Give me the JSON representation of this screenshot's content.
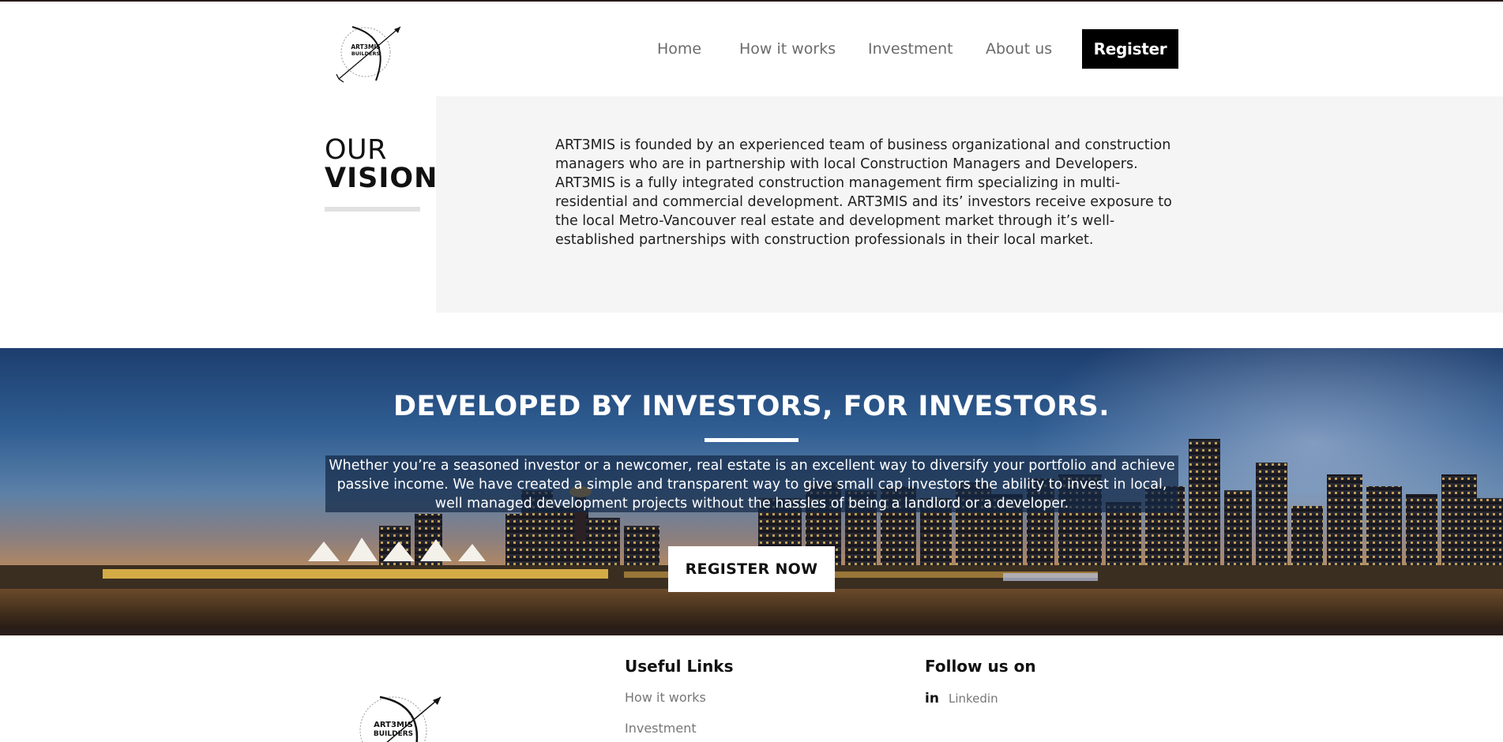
{
  "header": {
    "logo_text": "ART3MIS BUILDERS",
    "nav": [
      {
        "label": "Home"
      },
      {
        "label": "How it works"
      },
      {
        "label": "Investment"
      },
      {
        "label": "About us"
      }
    ],
    "register_label": "Register"
  },
  "vision": {
    "title_line1": "OUR",
    "title_line2": "VISION",
    "text": "ART3MIS is founded by an experienced team of business organizational and construction managers who are in partnership with local Construction Managers and Developers. ART3MIS is a fully integrated construction management firm specializing in multi-residential and commercial development. ART3MIS and its’ investors receive exposure to the local Metro-Vancouver real estate and development market through it’s well-established partnerships with construction professionals in their local market."
  },
  "hero": {
    "heading_light": "DEVELOPED BY INVESTORS, ",
    "heading_bold": "FOR INVESTORS.",
    "body": "Whether you’re a seasoned investor or a newcomer, real estate is an excellent way to diversify your portfolio and achieve passive income. We have created a simple and transparent way to give small cap investors the ability to invest in local, well managed development projects without the hassles of being a landlord or a developer.",
    "cta_label": "REGISTER NOW"
  },
  "footer": {
    "useful_links_title": "Useful Links",
    "useful_links": [
      "How it works",
      "Investment"
    ],
    "follow_title": "Follow us on",
    "social": [
      {
        "icon": "linkedin-icon",
        "label": "Linkedin"
      }
    ],
    "logo_text": "ART3MIS BUILDERS"
  },
  "colors": {
    "register_bg": "#000000",
    "vision_bg": "#f5f5f5",
    "nav_text": "#6b6b6b",
    "footer_link": "#777777"
  }
}
